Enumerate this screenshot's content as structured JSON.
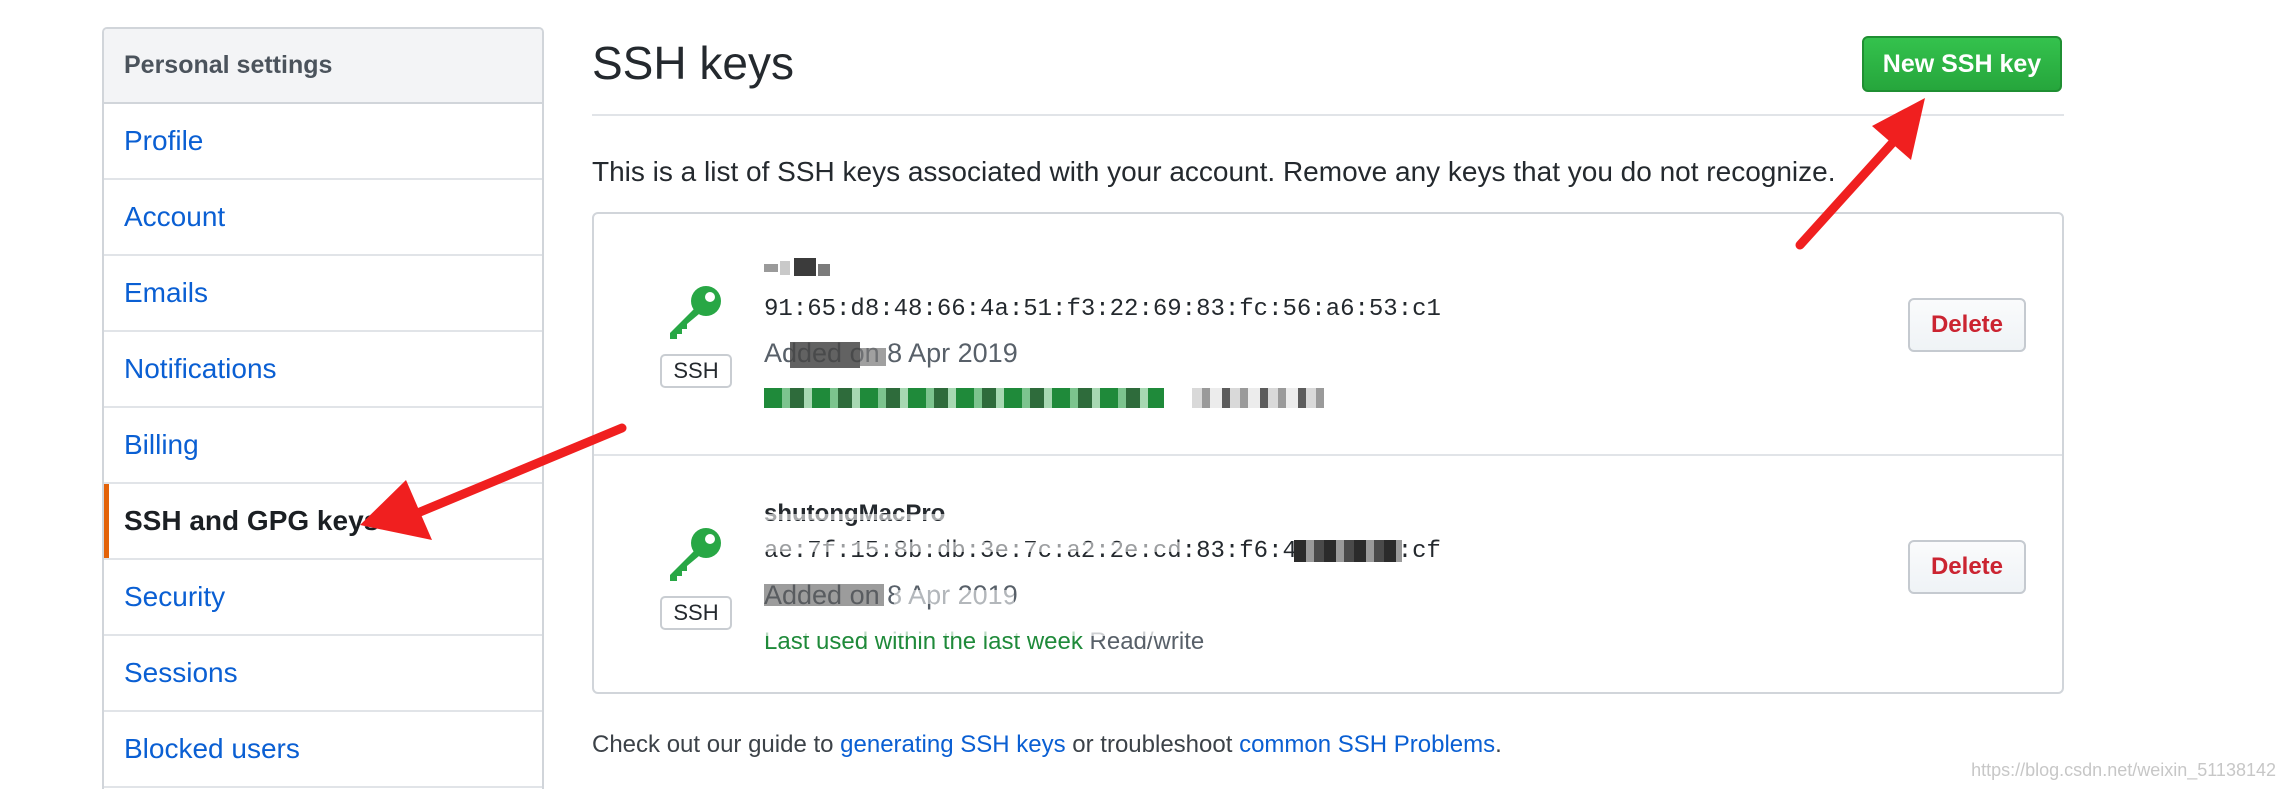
{
  "sidebar": {
    "header": "Personal settings",
    "items": [
      {
        "label": "Profile"
      },
      {
        "label": "Account"
      },
      {
        "label": "Emails"
      },
      {
        "label": "Notifications"
      },
      {
        "label": "Billing"
      },
      {
        "label": "SSH and GPG keys",
        "selected": true
      },
      {
        "label": "Security"
      },
      {
        "label": "Sessions"
      },
      {
        "label": "Blocked users"
      }
    ]
  },
  "main": {
    "title": "SSH keys",
    "new_button": "New SSH key",
    "intro": "This is a list of SSH keys associated with your account. Remove any keys that you do not recognize.",
    "keys": [
      {
        "badge": "SSH",
        "title": "",
        "fingerprint": "91:65:d8:48:66:4a:51:f3:22:69:83:fc:56:a6:53:c1",
        "added": "Added on 8 Apr 2019",
        "last_used": "",
        "access": "",
        "delete": "Delete"
      },
      {
        "badge": "SSH",
        "title": "shutongMacPro",
        "fingerprint": "ae:7f:15:8b:db:3e:7c:a2:2e:cd:83:f6:48:c4:92:cf",
        "added": "Added on 8 Apr 2019",
        "last_used": "Last used within the last week",
        "access": "Read/write",
        "delete": "Delete"
      }
    ],
    "footer": {
      "prefix": "Check out our guide to ",
      "link1": "generating SSH keys",
      "middle": " or troubleshoot ",
      "link2": "common SSH Problems",
      "suffix": "."
    }
  },
  "watermark": "https://blog.csdn.net/weixin_51138142",
  "colors": {
    "link": "#0a5fd3",
    "primary_button": "#28a745",
    "danger": "#cb2431",
    "key_icon": "#28a745",
    "annotation_arrow": "#f01f1f",
    "selected_indicator": "#e36209"
  }
}
